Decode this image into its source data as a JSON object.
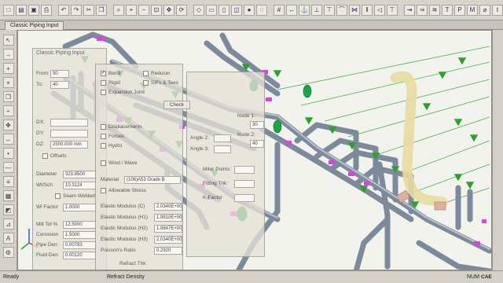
{
  "window": {
    "tab_title": "Classic Piping Input"
  },
  "dialog_main": {
    "title": "Classic Piping Input",
    "from_label": "From:",
    "from_value": "30",
    "to_label": "To:",
    "to_value": "40",
    "dx_label": "DX:",
    "dy_label": "DY:",
    "dz_label": "DZ:",
    "dz_value": "2500.000 mm",
    "offsets_label": "Offsets",
    "diameter_label": "Diameter",
    "diameter_value": "323.8500",
    "wtsch_label": "Wt/Sch",
    "wtsch_value": "10.3124",
    "seam_welded_label": "Seam Welded",
    "wl_factor_label": "Wl Factor",
    "wl_factor_value": "1.0000",
    "mill_tol_label": "Mill Tol %",
    "mill_tol_value": "12.5000",
    "corrosion_label": "Corrosion",
    "corrosion_value": "1.5000",
    "pipe_den_label": "Pipe Den",
    "pipe_den_value": "0.00783",
    "fluid_den_label": "Fluid Den",
    "fluid_den_value": "0.00120"
  },
  "dialog_mid": {
    "bend_label": "Bend",
    "rigid_label": "Rigid",
    "expansion_joint_label": "Expansion Joint",
    "reducer_label": "Reducer",
    "sifs_label": "SIFs & Tees",
    "displacements_label": "Displacements",
    "forces_label": "Forces",
    "hydro_label": "Hydro",
    "wind_wave_label": "Wind / Wave",
    "material_label": "Material",
    "material_value": "(106)A53 Grade B",
    "allowable_stress_label": "Allowable Stress",
    "elastic_c_label": "Elastic Modulus (C)",
    "elastic_c_value": "2.0340E+008",
    "elastic_h1_label": "Elastic Modulus (H1)",
    "elastic_h1_value": "1.9810E+008",
    "elastic_h2_label": "Elastic Modulus (H2)",
    "elastic_h2_value": "1.9847E+008",
    "elastic_h3_label": "Elastic Modulus (H3)",
    "elastic_h3_value": "2.0340E+008",
    "poisson_label": "Poisson's Ratio",
    "poisson_value": "0.2920",
    "refract_thk_label": "Refract Thk",
    "refract_density_label": "Refract Density"
  },
  "dialog_right": {
    "node1_label": "Node 1:",
    "node1_value": "30",
    "node2_label": "Node 2:",
    "node2_value": "40",
    "angle2_label": "Angle 2:",
    "angle3_label": "Angle 3:",
    "miter_points_label": "Miter Points:",
    "fitting_thk_label": "Fitting Thk:",
    "kfactor_label": "K-Factor",
    "check_label": "Check"
  },
  "status_bar": {
    "ready": "Ready",
    "num": "NUM",
    "logo": "CAE"
  },
  "colors": {
    "pipe": "#9aa8b8",
    "support": "#2ea02e",
    "node": "#e040e0",
    "bend_highlight": "#f0e080",
    "nozzle": "#d8a890",
    "flange": "#1aa34a"
  }
}
